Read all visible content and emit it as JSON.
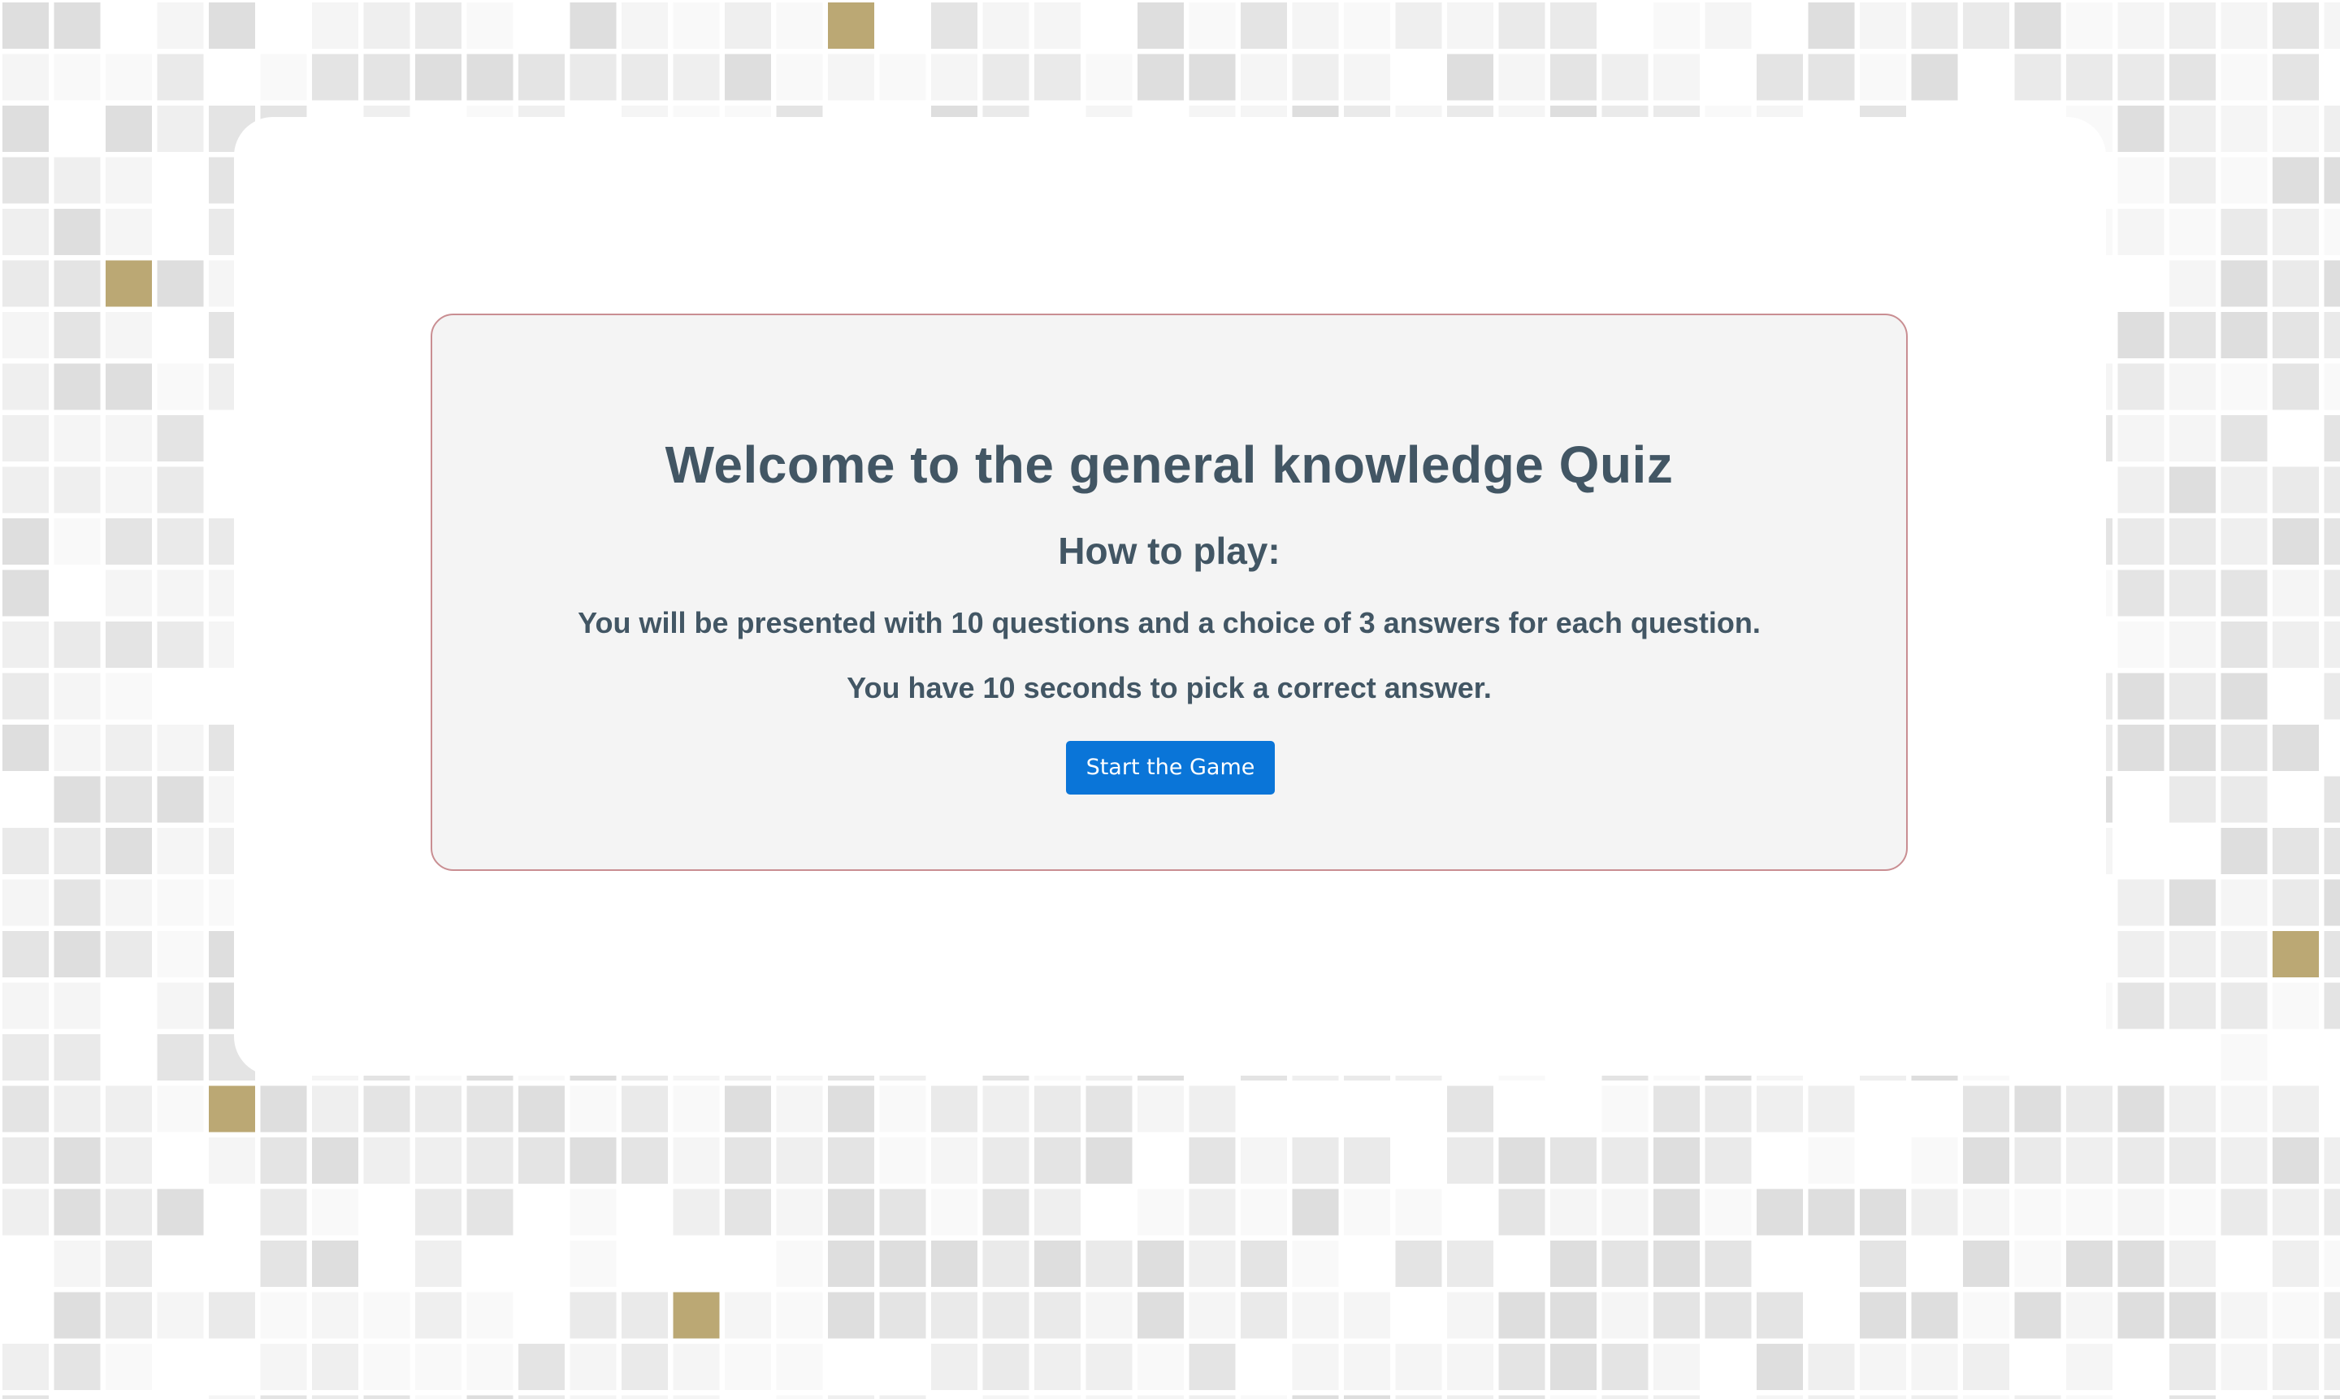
{
  "quiz": {
    "title": "Welcome to the general knowledge Quiz",
    "subtitle": "How to play:",
    "rules": [
      "You will be presented with 10 questions and a choice of 3 answers for each question.",
      "You have 10 seconds to pick a correct answer."
    ],
    "start_label": "Start the Game"
  },
  "colors": {
    "panel_bg": "#f4f4f4",
    "panel_border": "#c98e92",
    "text": "#425664",
    "button": "#0a75d8",
    "accent_tile": "#bba874"
  }
}
